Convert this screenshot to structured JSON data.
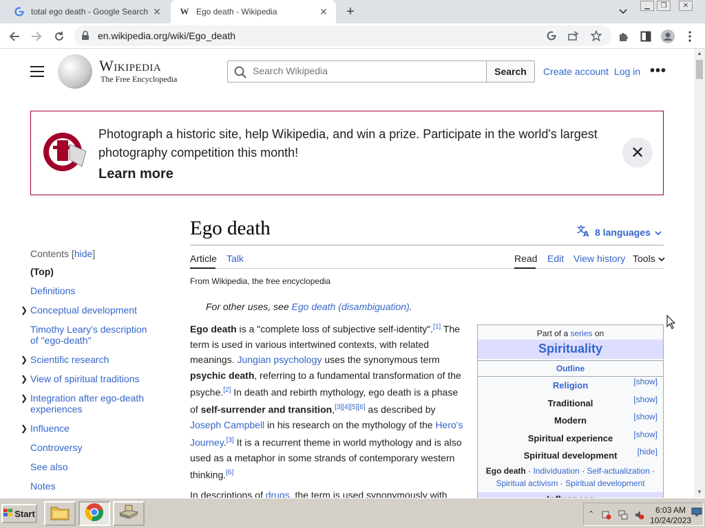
{
  "browser": {
    "tabs": [
      {
        "title": "total ego death - Google Search",
        "favicon": "google-g-icon"
      },
      {
        "title": "Ego death - Wikipedia",
        "favicon": "wikipedia-w-icon",
        "active": true
      }
    ],
    "url": "en.wikipedia.org/wiki/Ego_death"
  },
  "header": {
    "wordmark": "Wikipedia",
    "tagline": "The Free Encyclopedia",
    "search_placeholder": "Search Wikipedia",
    "search_button": "Search",
    "create_account": "Create account",
    "log_in": "Log in"
  },
  "banner": {
    "text": "Photograph a historic site, help Wikipedia, and win a prize. Participate in the world's largest photography competition this month!",
    "learn_more": "Learn more",
    "accent": "#a2002a"
  },
  "toc": {
    "heading": "Contents",
    "hide_label": "hide",
    "items": [
      {
        "label": "(Top)",
        "bold": true,
        "expandable": false
      },
      {
        "label": "Definitions",
        "expandable": false
      },
      {
        "label": "Conceptual development",
        "expandable": true
      },
      {
        "label": "Timothy Leary's description of \"ego-death\"",
        "expandable": false
      },
      {
        "label": "Scientific research",
        "expandable": true
      },
      {
        "label": "View of spiritual traditions",
        "expandable": true
      },
      {
        "label": "Integration after ego-death experiences",
        "expandable": true
      },
      {
        "label": "Influence",
        "expandable": true
      },
      {
        "label": "Controversy",
        "expandable": false
      },
      {
        "label": "See also",
        "expandable": false
      },
      {
        "label": "Notes",
        "expandable": false
      }
    ]
  },
  "article": {
    "title": "Ego death",
    "languages": "8 languages",
    "tabs": {
      "article": "Article",
      "talk": "Talk",
      "read": "Read",
      "edit": "Edit",
      "history": "View history",
      "tools": "Tools"
    },
    "from": "From Wikipedia, the free encyclopedia",
    "hatnote_prefix": "For other uses, see ",
    "hatnote_link": "Ego death (disambiguation)",
    "hatnote_suffix": "."
  },
  "infobox": {
    "part_of": "Part of a",
    "series": "series",
    "on": "on",
    "title": "Spirituality",
    "outline": "Outline",
    "rows": [
      {
        "label": "Religion",
        "toggle": "[show]",
        "link": true
      },
      {
        "label": "Traditional",
        "toggle": "[show]"
      },
      {
        "label": "Modern",
        "toggle": "[show]"
      },
      {
        "label": "Spiritual experience",
        "toggle": "[show]"
      },
      {
        "label": "Spiritual development",
        "toggle": "[hide]"
      }
    ],
    "dev_items": [
      "Ego death",
      "Individuation",
      "Self-actualization",
      "Spiritual activism",
      "Spiritual development"
    ],
    "influences": "Influences"
  },
  "taskbar": {
    "start": "Start",
    "time": "6:03 AM",
    "date": "10/24/2023"
  }
}
